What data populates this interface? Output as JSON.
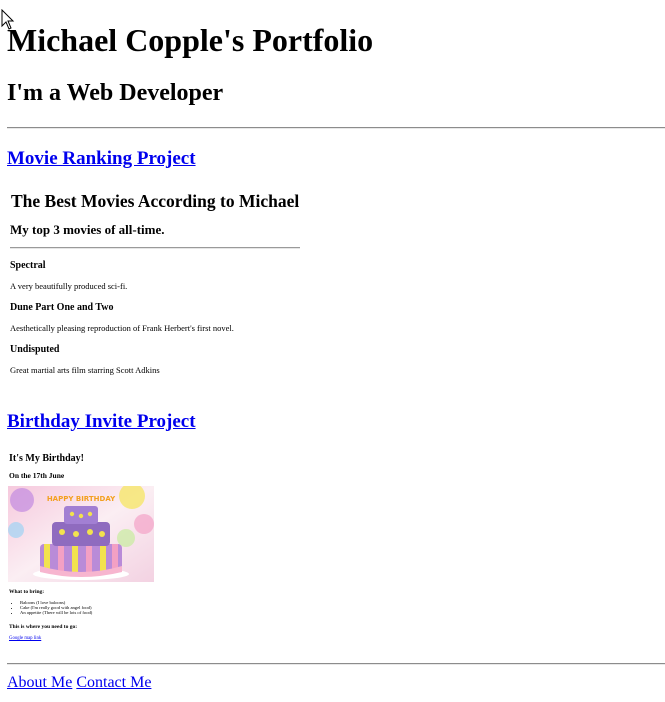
{
  "header": {
    "title": "Michael Copple's Portfolio",
    "subtitle": "I'm a Web Developer"
  },
  "projects": [
    {
      "link_label": "Movie Ranking Project"
    },
    {
      "link_label": "Birthday Invite Project"
    }
  ],
  "movie_page": {
    "title": "The Best Movies According to Michael",
    "subtitle": "My top 3 movies of all-time.",
    "movies": [
      {
        "name": "Spectral",
        "description": "A very beautifully produced sci-fi."
      },
      {
        "name": "Dune Part One and Two",
        "description": "Aesthetically pleasing reproduction of Frank Herbert's first novel."
      },
      {
        "name": "Undisputed",
        "description": "Great martial arts film starring Scott Adkins"
      }
    ]
  },
  "birthday_page": {
    "title": "It's My Birthday!",
    "date_line": "On the 17th June",
    "image_text": "HAPPY BIRTHDAY",
    "bring_heading": "What to bring:",
    "bring_items": [
      "Baloons (I love baloons)",
      "Cake (I'm really good with angel food)",
      "An appetite (There will be lots of food)"
    ],
    "where_heading": "This is where you need to go:",
    "map_link": "Google map link"
  },
  "footer": {
    "about_label": "About Me",
    "contact_label": "Contact Me"
  },
  "colors": {
    "link": "#0000ee",
    "rule": "#8c8c8c"
  }
}
